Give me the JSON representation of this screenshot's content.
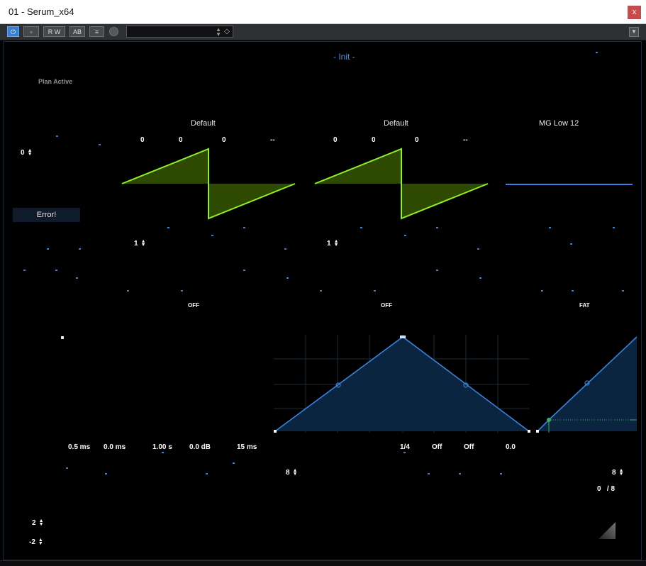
{
  "window": {
    "title": "01 - Serum_x64",
    "close_glyph": "x"
  },
  "toolbar": {
    "buttons": [
      {
        "name": "power-button",
        "glyph": "⏻"
      },
      {
        "name": "bypass-button",
        "glyph": "▫"
      },
      {
        "name": "read-write-button",
        "glyph": "R W"
      },
      {
        "name": "ab-compare-button",
        "glyph": "AB"
      },
      {
        "name": "settings-button",
        "glyph": "≡"
      },
      {
        "name": "sidechain-button",
        "glyph": ""
      }
    ],
    "preset_value": "",
    "menu_glyph": "▼"
  },
  "plugin": {
    "preset_name": "- Init -",
    "plan_status": "Plan Active",
    "error_label": "Error!",
    "oscillators": [
      {
        "name": "Default",
        "params": [
          "0",
          "0",
          "0",
          "--"
        ],
        "octave": "1",
        "warp": "OFF",
        "wave": "saw"
      },
      {
        "name": "Default",
        "params": [
          "0",
          "0",
          "0",
          "--"
        ],
        "octave": "1",
        "warp": "OFF",
        "wave": "saw"
      },
      {
        "name": "MG Low 12",
        "params": [],
        "octave": "",
        "warp": "FAT",
        "wave": "flat"
      }
    ],
    "left_spinner": "0",
    "envelope_values": [
      "0.5 ms",
      "0.0 ms",
      "1.00 s",
      "0.0 dB",
      "15 ms"
    ],
    "lfo_values": [
      "1/4",
      "Off",
      "Off",
      "0.0"
    ],
    "lfo_grid_spinner": "8",
    "lfo_right_spinner": "8",
    "voices": {
      "current": "0",
      "separator": "/",
      "max": "8"
    },
    "pitch_spinners": [
      "2",
      "-2"
    ]
  },
  "colors": {
    "accent_blue": "#4e8fe0",
    "wave_green": "#8fef2a",
    "wave_fill": "#2d4a00",
    "env_line": "#3c82dc",
    "env_fill": "#0b2540",
    "close_red": "#c64c4c"
  }
}
